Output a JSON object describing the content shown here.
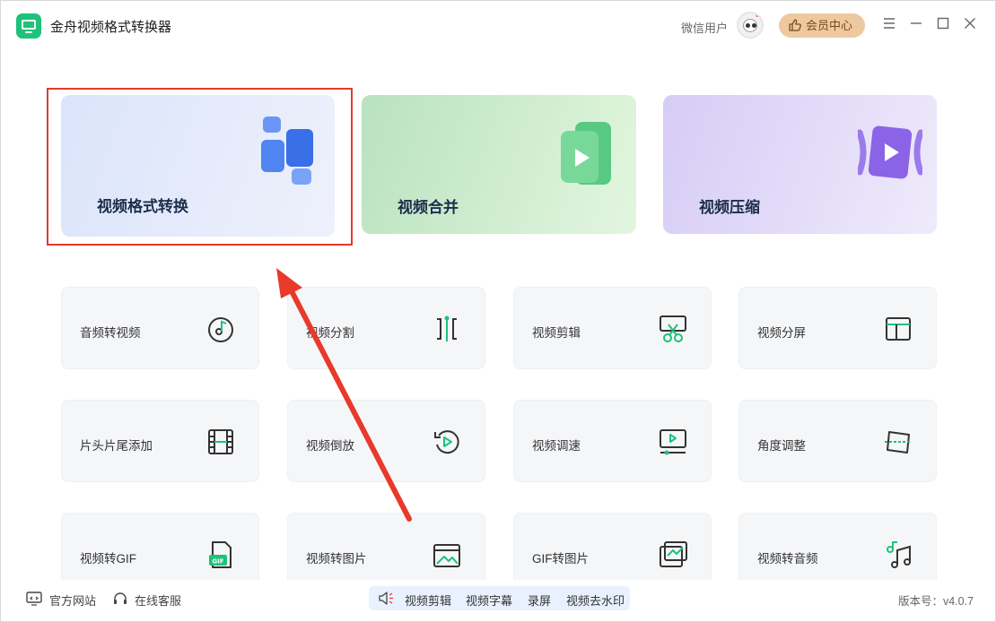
{
  "app": {
    "title": "金舟视频格式转换器"
  },
  "header": {
    "user_name": "微信用户",
    "vip_label": "会员中心"
  },
  "hero_cards": [
    {
      "label": "视频格式转换"
    },
    {
      "label": "视频合并"
    },
    {
      "label": "视频压缩"
    }
  ],
  "tools": [
    {
      "label": "音频转视频",
      "icon": "audio-disc-icon"
    },
    {
      "label": "视频分割",
      "icon": "split-icon"
    },
    {
      "label": "视频剪辑",
      "icon": "scissors-icon"
    },
    {
      "label": "视频分屏",
      "icon": "split-screen-icon"
    },
    {
      "label": "片头片尾添加",
      "icon": "film-strip-icon"
    },
    {
      "label": "视频倒放",
      "icon": "reverse-play-icon"
    },
    {
      "label": "视频调速",
      "icon": "speed-monitor-icon"
    },
    {
      "label": "角度调整",
      "icon": "rotate-frame-icon"
    },
    {
      "label": "视频转GIF",
      "icon": "gif-file-icon"
    },
    {
      "label": "视频转图片",
      "icon": "image-icon"
    },
    {
      "label": "GIF转图片",
      "icon": "image-chart-icon"
    },
    {
      "label": "视频转音频",
      "icon": "music-notes-icon"
    }
  ],
  "footer": {
    "site_label": "官方网站",
    "service_label": "在线客服",
    "quick_links": [
      "视频剪辑",
      "视频字幕",
      "录屏",
      "视频去水印"
    ],
    "version": "版本号：v4.0.7"
  },
  "colors": {
    "accent_green": "#1ec27a",
    "highlight_red": "#e23b2e",
    "vip_gold": "#eec9a0"
  }
}
